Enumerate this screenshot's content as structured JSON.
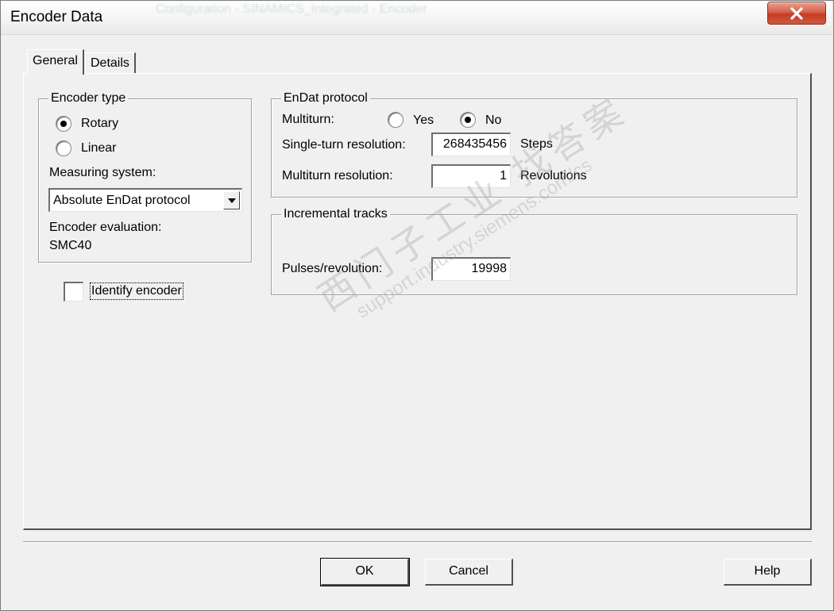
{
  "window": {
    "title": "Encoder Data",
    "background_title": "Configuration - SINAMICS_Integrated - Encoder"
  },
  "tabs": [
    {
      "label": "General",
      "active": true
    },
    {
      "label": "Details",
      "active": false
    }
  ],
  "encoder_type": {
    "group_label": "Encoder type",
    "options": [
      {
        "label": "Rotary",
        "checked": true
      },
      {
        "label": "Linear",
        "checked": false
      }
    ],
    "measuring_system_label": "Measuring system:",
    "measuring_system_value": "Absolute EnDat protocol",
    "evaluation_label": "Encoder evaluation:",
    "evaluation_value": "SMC40"
  },
  "identify": {
    "label": "Identify encoder",
    "checked": false
  },
  "endat": {
    "group_label": "EnDat protocol",
    "multiturn_label": "Multiturn:",
    "yes_label": "Yes",
    "no_label": "No",
    "multiturn_selected": "No",
    "singleturn_label": "Single-turn resolution:",
    "singleturn_value": "268435456",
    "singleturn_unit": "Steps",
    "multiturn_res_label": "Multiturn resolution:",
    "multiturn_res_value": "1",
    "multiturn_res_unit": "Revolutions"
  },
  "incremental": {
    "group_label": "Incremental tracks",
    "pulses_label": "Pulses/revolution:",
    "pulses_value": "19998"
  },
  "buttons": {
    "ok": "OK",
    "cancel": "Cancel",
    "help": "Help"
  },
  "watermark": {
    "cn_text": "西门子工业 找答案",
    "url_text": "support.industry.siemens.com/cs"
  },
  "colors": {
    "close_button": "#c43c24",
    "face": "#f0f0f0"
  }
}
